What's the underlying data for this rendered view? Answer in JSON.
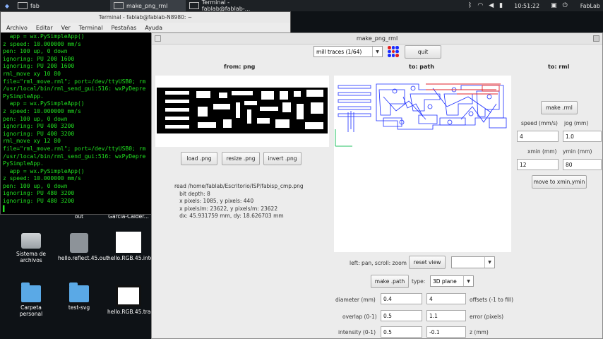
{
  "taskbar": {
    "app_windows": [
      {
        "label": "fab"
      },
      {
        "label": "make_png_rml"
      },
      {
        "label": "Terminal - fablab@fablab-..."
      }
    ],
    "clock": "10:51:22",
    "user": "FabLab"
  },
  "desktop_icons": [
    {
      "label": "out"
    },
    {
      "label": "Garcia-Calder..."
    },
    {
      "label": "Sistema de archivos"
    },
    {
      "label": "hello.reflect.45.out"
    },
    {
      "label": "hello.RGB.45.interior.png"
    },
    {
      "label": "Carpeta personal"
    },
    {
      "label": "test-svg"
    },
    {
      "label": "hello.RGB.45.traces.png"
    }
  ],
  "terminal": {
    "title": "Terminal - fablab@fablab-N8980: ~",
    "menu": [
      "Archivo",
      "Editar",
      "Ver",
      "Terminal",
      "Pestañas",
      "Ayuda"
    ],
    "lines": [
      "  app = wx.PySimpleApp()",
      "z speed: 10.000000 mm/s",
      "pen: 100 up, 0 down",
      "ignoring: PU 200 1600",
      "ignoring: PU 200 1600",
      "rml_move xy 10 80",
      "file=\"rml_move.rml\"; port=/dev/ttyUSB0; rm",
      "/usr/local/bin/rml_send_gui:516: wxPyDepre",
      "PySimpleApp.",
      "  app = wx.PySimpleApp()",
      "z speed: 10.000000 mm/s",
      "pen: 100 up, 0 down",
      "ignoring: PU 400 3200",
      "ignoring: PU 400 3200",
      "rml_move xy 12 80",
      "file=\"rml_move.rml\"; port=/dev/ttyUSB0; rm",
      "/usr/local/bin/rml_send_gui:516: wxPyDepre",
      "PySimpleApp.",
      "  app = wx.PySimpleApp()",
      "z speed: 10.000000 mm/s",
      "pen: 100 up, 0 down",
      "ignoring: PU 480 3200",
      "ignoring: PU 480 3200",
      "▌"
    ]
  },
  "app": {
    "title": "make_png_rml",
    "mode_select": "mill traces (1/64)",
    "quit_label": "quit",
    "headers": {
      "from": "from: png",
      "to_path": "to: path",
      "to_rml": "to: rml"
    },
    "png_buttons": {
      "load": "load .png",
      "resize": "resize .png",
      "invert": "invert .png"
    },
    "info_lines": [
      "read /home/fablab/Escritorio/ISP/fabisp_cmp.png",
      "   bit depth: 8",
      "   x pixels: 1085, y pixels: 440",
      "   x pixels/m: 23622, y pixels/m: 23622",
      "   dx: 45.931759 mm, dy: 18.626703 mm"
    ],
    "rml": {
      "make_label": "make .rml",
      "speed_label": "speed (mm/s)",
      "jog_label": "jog (mm)",
      "speed_value": "4",
      "jog_value": "1.0",
      "xmin_label": "xmin (mm)",
      "ymin_label": "ymin (mm)",
      "xmin_value": "12",
      "ymin_value": "80",
      "move_label": "move to xmin,ymin"
    },
    "view": {
      "hint": "left: pan, scroll: zoom",
      "reset_label": "reset view",
      "select_value": ""
    },
    "path": {
      "make_label": "make .path",
      "type_label": "type:",
      "type_value": "3D plane",
      "diameter_label": "diameter (mm)",
      "diameter_value": "0.4",
      "offsets_value": "4",
      "offsets_label": "offsets (-1 to fill)",
      "overlap_label": "overlap (0-1)",
      "overlap_value": "0.5",
      "error_value": "1.1",
      "error_label": "error (pixels)",
      "intensity_label": "intensity (0-1)",
      "intensity_value": "0.5",
      "z_value": "-0.1",
      "z_label": "z (mm)"
    },
    "colors": {
      "path_blue": "#1a2cff",
      "path_red": "#e0202a",
      "axis_green": "#20c060"
    }
  }
}
